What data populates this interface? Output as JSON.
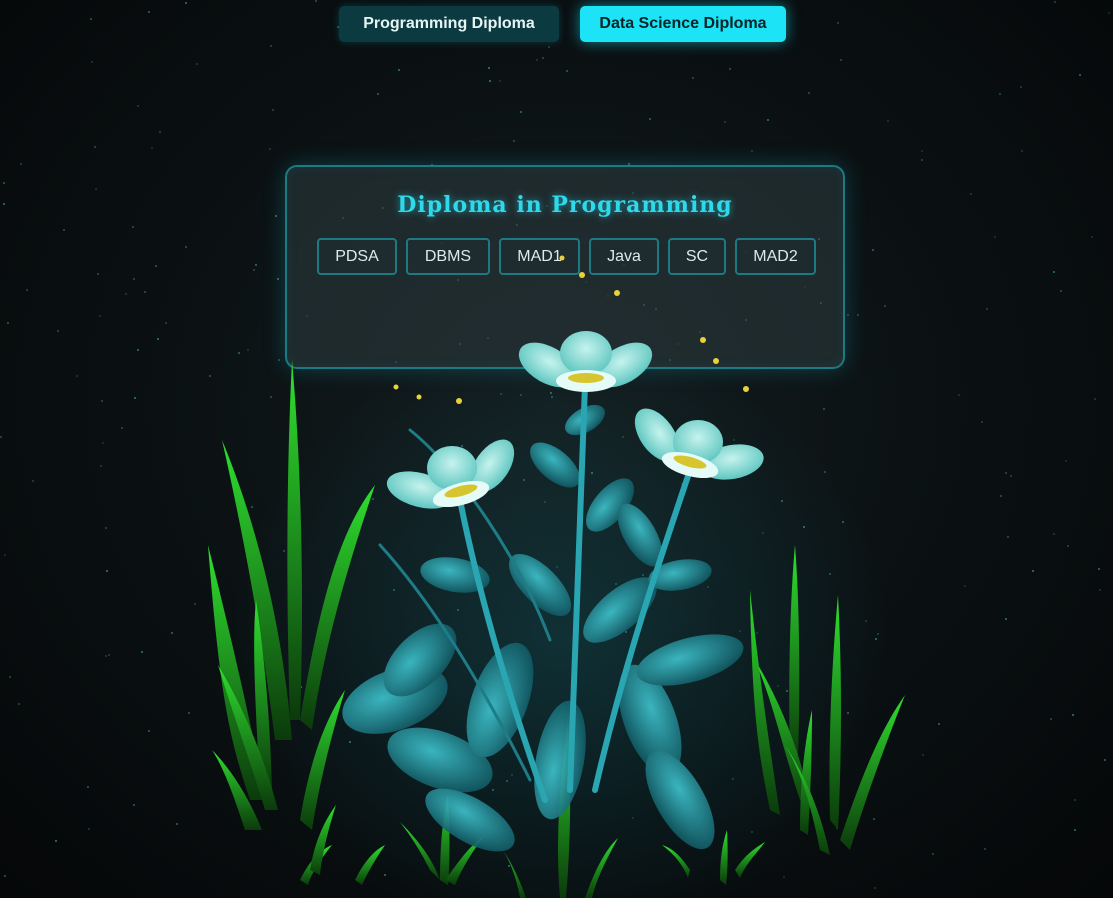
{
  "top_tabs": {
    "programming_label": "Programming Diploma",
    "data_science_label": "Data Science Diploma"
  },
  "panel": {
    "title": "Diploma in Programming",
    "courses": [
      "PDSA",
      "DBMS",
      "MAD1",
      "Java",
      "SC",
      "MAD2"
    ]
  },
  "colors": {
    "accent": "#1ce3f5",
    "title": "#2fd9ec",
    "grass": "#2bd12b",
    "petal": "#7fe0d6",
    "leaf": "#1f8b96",
    "firefly": "#e8d23a"
  }
}
